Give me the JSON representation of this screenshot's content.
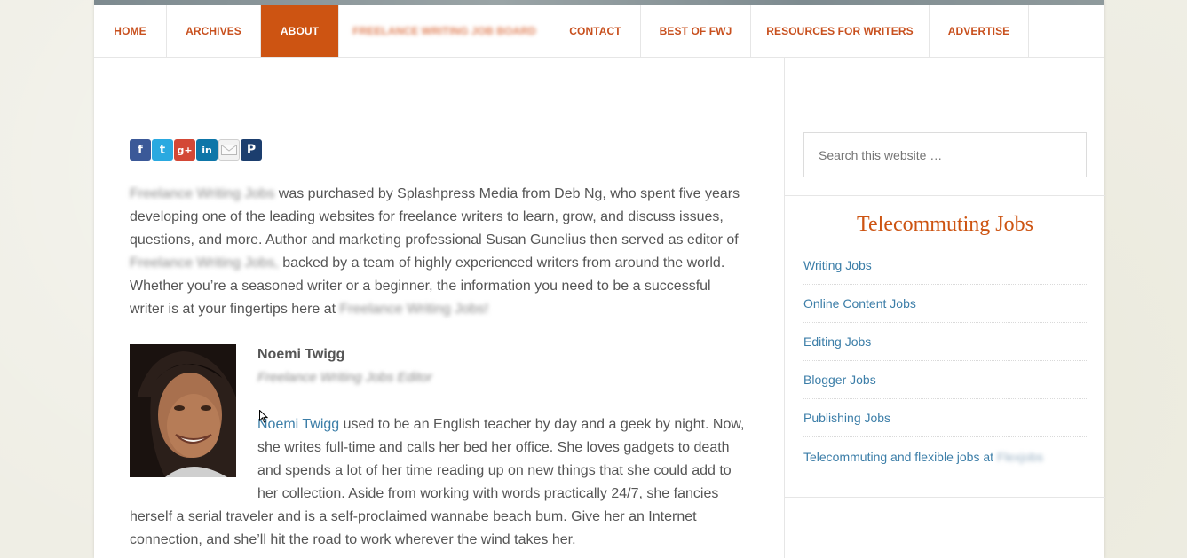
{
  "nav": {
    "items": [
      {
        "label": "HOME",
        "active": false,
        "blurred": false
      },
      {
        "label": "ARCHIVES",
        "active": false,
        "blurred": false
      },
      {
        "label": "ABOUT",
        "active": true,
        "blurred": false
      },
      {
        "label": "FREELANCE WRITING JOB BOARD",
        "active": false,
        "blurred": true
      },
      {
        "label": "CONTACT",
        "active": false,
        "blurred": false
      },
      {
        "label": "BEST OF FWJ",
        "active": false,
        "blurred": false
      },
      {
        "label": "RESOURCES FOR WRITERS",
        "active": false,
        "blurred": false
      },
      {
        "label": "ADVERTISE",
        "active": false,
        "blurred": false
      }
    ]
  },
  "share": {
    "buttons": [
      {
        "icon": "facebook-icon",
        "glyph": "f"
      },
      {
        "icon": "twitter-icon",
        "glyph": "t"
      },
      {
        "icon": "google-plus-icon",
        "glyph": "g+"
      },
      {
        "icon": "linkedin-icon",
        "glyph": "in"
      },
      {
        "icon": "email-icon",
        "glyph": "✉"
      },
      {
        "icon": "pocket-icon",
        "glyph": "P"
      }
    ]
  },
  "intro": {
    "site_name_1": "Freelance Writing Jobs",
    "text_1": " was purchased by Splashpress Media from Deb Ng, who spent five years developing one of the leading websites for freelance writers to learn, grow, and discuss issues, questions, and more.  Author and marketing professional Susan Gunelius then served as editor of ",
    "site_name_2": "Freelance Writing Jobs,",
    "text_2": " backed by a team of highly experienced writers from around the world.  Whether you’re a seasoned writer or a beginner, the information you need to be a successful writer is at your fingertips here at ",
    "site_name_3": "Freelance Writing Jobs!"
  },
  "author": {
    "name": "Noemi Twigg",
    "role": "Freelance Writing Jobs Editor",
    "link_text": "Noemi Twigg",
    "bio": " used to be an English teacher by day and a geek by night. Now, she writes full-time and calls her bed her office. She loves gadgets to death and spends a lot of her time reading up on new things that she could add to her collection. Aside from working with words practically 24/7, she fancies herself a serial traveler and is a self-proclaimed wannabe beach bum. Give her an Internet connection, and she’ll hit the road to work wherever the wind takes her."
  },
  "sidebar": {
    "search_placeholder": "Search this website …",
    "title": "Telecommuting Jobs",
    "jobs": [
      {
        "label": "Writing Jobs"
      },
      {
        "label": "Online Content Jobs"
      },
      {
        "label": "Editing Jobs"
      },
      {
        "label": "Blogger Jobs"
      },
      {
        "label": "Publishing Jobs"
      },
      {
        "label": "Telecommuting and flexible jobs at ",
        "suffix": "Flexjobs"
      }
    ]
  },
  "colors": {
    "accent": "#cd5412",
    "link": "#3c7ea8",
    "text": "#555555"
  }
}
